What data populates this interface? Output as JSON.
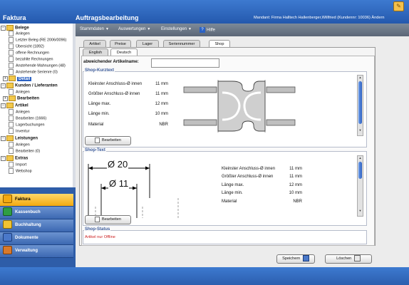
{
  "window": {
    "left_title": "Faktura",
    "main_title": "Auftragsbearbeitung",
    "client_info": "Mandant: Firma Halltech Hallenberger,Willfried  (Kundennr: 10036)  Ändern"
  },
  "tree": {
    "groups": [
      {
        "label": "Belege",
        "items": [
          "Anlegen",
          "Letzter Beleg  (RE 2006/0096)",
          "Übersicht  (1892)",
          "offene Rechnungen",
          "bezahlte Rechnungen",
          "Anstehende Mahnungen  (48)",
          "Anstehende Serienre  (0)"
        ],
        "sub": "Detail"
      },
      {
        "label": "Kunden / Lieferanten",
        "items": [
          "Anlegen"
        ],
        "sub": "Bearbeiten"
      },
      {
        "label": "Artikel",
        "items": [
          "Anlegen",
          "Bearbeiten  (1666)",
          "Lagerbuchungen",
          "Inventur"
        ]
      },
      {
        "label": "Leistungen",
        "items": [
          "Anlegen",
          "Bearbeiten  (0)"
        ]
      },
      {
        "label": "Extras",
        "items": [
          "Import",
          "Webshop"
        ]
      }
    ]
  },
  "nav": [
    {
      "label": "Faktura",
      "color": "#f3a90f"
    },
    {
      "label": "Kassenbuch",
      "color": "#2f9e44"
    },
    {
      "label": "Buchhaltung",
      "color": "#f0c232"
    },
    {
      "label": "Dokumente",
      "color": "#4a78c9"
    },
    {
      "label": "Verwaltung",
      "color": "#d9792b"
    }
  ],
  "menu": {
    "stammdaten": "Stammdaten",
    "auswertungen": "Auswertungen",
    "einstellungen": "Einstellungen",
    "hilfe": "Hilfe"
  },
  "tabs": {
    "main": [
      "Artikel",
      "Preise",
      "Lager",
      "Seriennummer",
      "Shop"
    ],
    "lang": [
      "English",
      "Deutsch"
    ]
  },
  "form": {
    "alt_name_label": "abweichender Artikelname:",
    "alt_name_value": ""
  },
  "kurztext": {
    "title": "Shop-Kurztext",
    "rows": [
      {
        "k": "Kleinster Anschluss-Ø innen",
        "v": "11 mm"
      },
      {
        "k": "Größter Anschluss-Ø innen",
        "v": "11 mm"
      },
      {
        "k": "Länge max.",
        "v": "12 mm"
      },
      {
        "k": "Länge min.",
        "v": "10 mm"
      },
      {
        "k": "Material",
        "v": "NBR"
      }
    ],
    "button": "Bearbeiten"
  },
  "shoptext": {
    "title": "Shop-Text",
    "dim1": "Ø 20",
    "dim2": "Ø 11",
    "rows": [
      {
        "k": "Kleinster Anschluss-Ø innen",
        "v": "11 mm"
      },
      {
        "k": "Größter Anschluss-Ø innen",
        "v": "11 mm"
      },
      {
        "k": "Länge max.",
        "v": "12 mm"
      },
      {
        "k": "Länge min.",
        "v": "10 mm"
      },
      {
        "k": "Material",
        "v": "NBR"
      }
    ],
    "button": "Bearbeiten"
  },
  "status": {
    "title": "Shop-Status",
    "text": "Artikel nur Offline",
    "text_color": "#cc2222"
  },
  "actions": {
    "save": "Speichern",
    "delete": "Löschen"
  }
}
